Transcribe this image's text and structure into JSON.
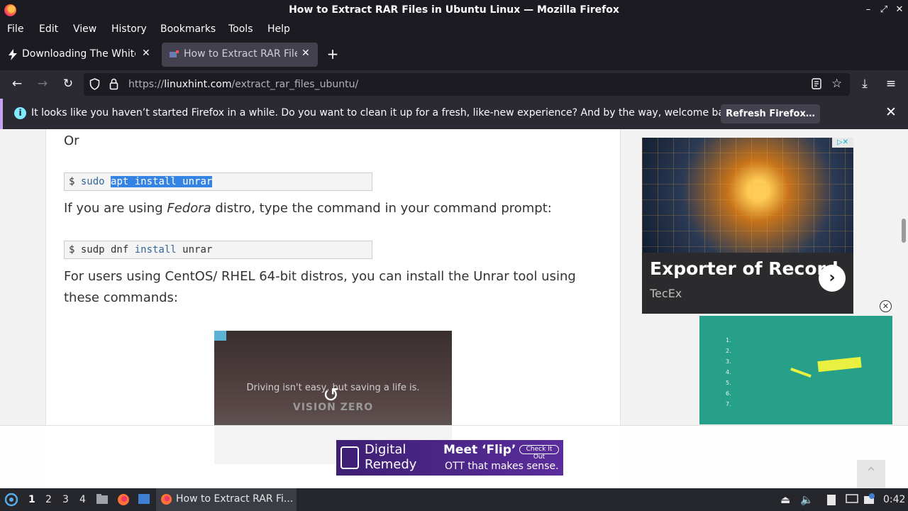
{
  "window": {
    "title": "How to Extract RAR Files in Ubuntu Linux — Mozilla Firefox",
    "controls": [
      "–",
      "⤢",
      "✕"
    ]
  },
  "menu": [
    "File",
    "Edit",
    "View",
    "History",
    "Bookmarks",
    "Tools",
    "Help"
  ],
  "tabs": [
    {
      "label": "Downloading The White H",
      "active": false
    },
    {
      "label": "How to Extract RAR Files",
      "active": true
    }
  ],
  "new_tab": "+",
  "url": {
    "prefix": "https://",
    "domain": "linuxhint.com",
    "path": "/extract_rar_files_ubuntu/"
  },
  "notification": {
    "message": "It looks like you haven’t started Firefox in a while. Do you want to clean it up for a fresh, like-new experience? And by the way, welcome back!",
    "button": "Refresh Firefox…"
  },
  "article": {
    "or": "Or",
    "code1": {
      "prompt": "$ ",
      "cmd": "sudo ",
      "selected": "apt install unrar"
    },
    "fedora": {
      "pre": "If you are using ",
      "em": "Fedora",
      "post": " distro, type the command in your command prompt:"
    },
    "code2": {
      "prompt": "$ ",
      "cmd": "sudp dnf ",
      "kw": "install",
      "rest": " unrar"
    },
    "centos_line1": "For users using CentOS/ RHEL 64-bit distros, you can install the Unrar tool using",
    "centos_line2": "these commands:"
  },
  "video_ad": {
    "text": "Driving isn't easy, but saving a life is.",
    "brand": "VISION ZERO"
  },
  "ad_exporter": {
    "headline": "Exporter of Record",
    "brand": "TecEx"
  },
  "ad_list": [
    "1.",
    "2.",
    "3.",
    "4.",
    "5.",
    "6.",
    "7."
  ],
  "ad_digital": {
    "brand_line1": "Digital",
    "brand_line2": "Remedy",
    "headline": "Meet ‘Flip’",
    "tagline": "OTT that makes sense.",
    "cta": "Check It Out"
  },
  "taskbar": {
    "workspaces": [
      "1",
      "2",
      "3",
      "4"
    ],
    "active_workspace": "1",
    "task": "How to Extract RAR Fi...",
    "clock": "0:42"
  }
}
